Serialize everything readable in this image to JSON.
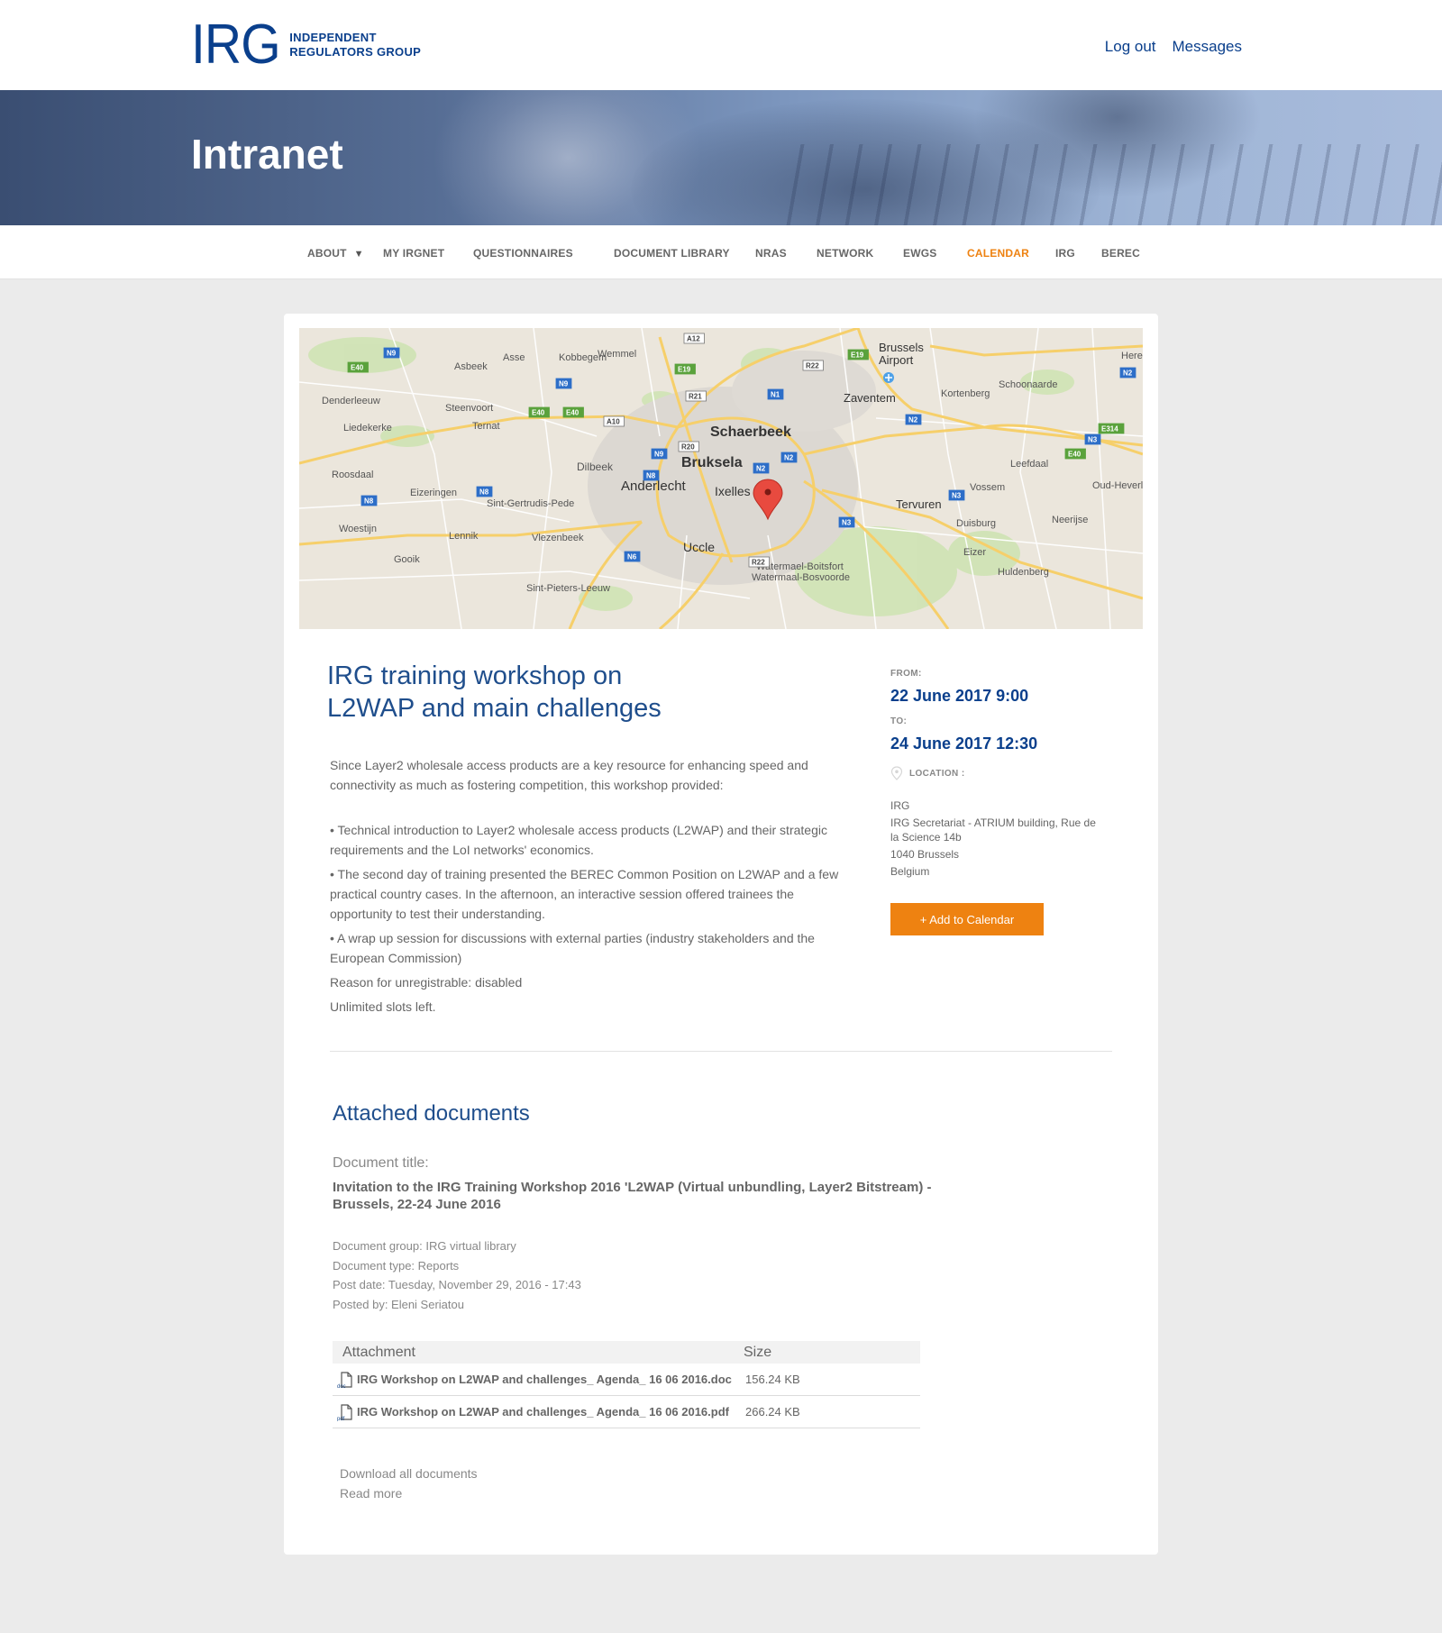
{
  "header": {
    "logo_mark": "IRG",
    "logo_line1": "INDEPENDENT",
    "logo_line2": "REGULATORS GROUP",
    "links": [
      "Log out",
      "Messages"
    ]
  },
  "hero": {
    "title": "Intranet"
  },
  "nav": {
    "items": [
      {
        "label": "ABOUT",
        "active": false
      },
      {
        "label": "MY IRGNET",
        "active": false
      },
      {
        "label": "QUESTIONNAIRES",
        "active": false
      },
      {
        "label": "DOCUMENT LIBRARY",
        "active": false
      },
      {
        "label": "NRAS",
        "active": false
      },
      {
        "label": "NETWORK",
        "active": false
      },
      {
        "label": "EWGS",
        "active": false
      },
      {
        "label": "CALENDAR",
        "active": true
      },
      {
        "label": "IRG",
        "active": false
      },
      {
        "label": "BEREC",
        "active": false
      }
    ],
    "caret": "▼",
    "active_color": "#ee8211"
  },
  "map": {
    "places": [
      "Asse",
      "Kobbegem",
      "Wemmel",
      "Brussels",
      "Airport",
      "Here",
      "Asbeek",
      "Denderleeuw",
      "Steenvoort",
      "Zaventem",
      "Kortenberg",
      "Schoonaarde",
      "Liedekerke",
      "Ternat",
      "Schaerbeek",
      "Leefdaal",
      "Roosdaal",
      "Dilbeek",
      "Bruksela",
      "Anderlecht",
      "Ixelles",
      "Vossem",
      "Oud-Heverle",
      "Eizeringen",
      "Sint-Gertrudis-Pede",
      "Tervuren",
      "Woestijn",
      "Lennik",
      "Vlezenbeek",
      "Duisburg",
      "Neerijse",
      "Uccle",
      "Gooik",
      "Eizer",
      "Huldenberg",
      "Watermael-Boitsfort",
      "Watermaal-Bosvoorde",
      "Sint-Pieters-Leeuw"
    ],
    "road_labels": [
      "A12",
      "N9",
      "E40",
      "N9",
      "E19",
      "R22",
      "E19",
      "R21",
      "N1",
      "E40",
      "E40",
      "A10",
      "N2",
      "E314",
      "R20",
      "N9",
      "N2",
      "N3",
      "E40",
      "N8",
      "N2",
      "N8",
      "N8",
      "N3",
      "N3",
      "N6",
      "R22",
      "N2"
    ],
    "marker": "red-map-pin"
  },
  "event": {
    "title_line1": "IRG training workshop on",
    "title_line2": "L2WAP and main challenges",
    "intro": "Since Layer2 wholesale access products are a key resource for enhancing speed and connectivity as much as fostering competition, this workshop provided:",
    "bullets": [
      "• Technical introduction to Layer2 wholesale access products (L2WAP) and their strategic requirements and the LoI networks' economics.",
      "• The second day of training presented the BEREC Common Position on L2WAP and a few practical country cases. In the afternoon, an interactive session offered trainees the opportunity to test their understanding.",
      "• A wrap up session for discussions with external parties (industry stakeholders and the European Commission)"
    ],
    "reason": "Reason for unregistrable: disabled",
    "slots": "Unlimited slots left.",
    "from_label": "FROM:",
    "from_date": "22 June 2017 9:00",
    "to_label": "TO:",
    "to_date": "24 June 2017 12:30",
    "location_label": "LOCATION :",
    "address": [
      "IRG",
      "IRG Secretariat - ATRIUM building, Rue de la Science 14b",
      "1040 Brussels",
      "Belgium"
    ],
    "add_button": "+ Add to Calendar"
  },
  "attachments": {
    "heading": "Attached documents",
    "doc_title_label": "Document title:",
    "doc_title": "Invitation to the IRG Training Workshop 2016 'L2WAP (Virtual unbundling, Layer2 Bitstream) - Brussels, 22-24 June 2016",
    "meta": [
      "Document group: IRG virtual library",
      "Document type: Reports",
      "Post date: Tuesday, November 29, 2016 - 17:43",
      "Posted by: Eleni Seriatou"
    ],
    "columns": [
      "Attachment",
      "Size"
    ],
    "files": [
      {
        "name": "IRG Workshop on L2WAP and challenges_ Agenda_ 16 06 2016.doc",
        "size": "156.24 KB",
        "icon": "doc-file-icon",
        "ext": "doc"
      },
      {
        "name": "IRG Workshop on L2WAP and challenges_ Agenda_ 16 06 2016.pdf",
        "size": "266.24 KB",
        "icon": "pdf-file-icon",
        "ext": "pdf"
      }
    ],
    "download_all": "Download all documents",
    "read_more": "Read more"
  }
}
